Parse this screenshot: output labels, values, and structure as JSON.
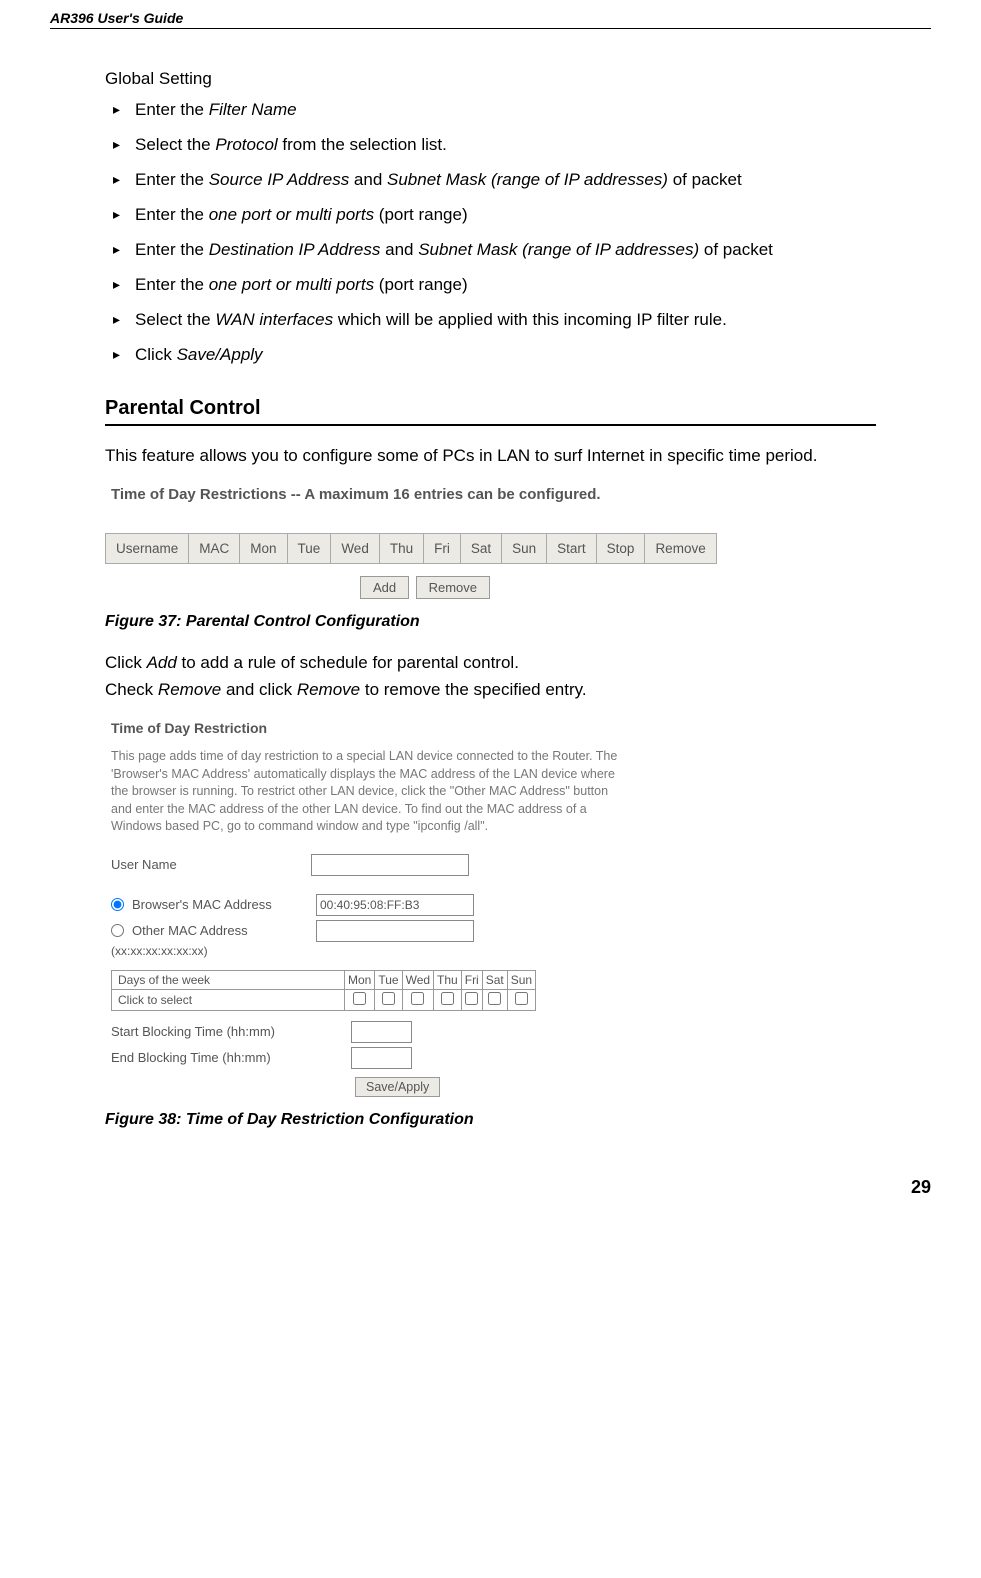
{
  "header": {
    "model": "AR396",
    "suffix": " User's Guide"
  },
  "global_setting": {
    "title": "Global Setting",
    "items": [
      {
        "pre": "Enter the ",
        "em": "Filter Name",
        "post": ""
      },
      {
        "pre": "Select the ",
        "em": "Protocol",
        "post": " from the selection list."
      },
      {
        "pre": "Enter the ",
        "em": "Source IP Address",
        "mid": " and ",
        "em2": "Subnet Mask (range of IP addresses)",
        "post": " of packet"
      },
      {
        "pre": "Enter the ",
        "em": "one port or multi ports",
        "post": " (port range)"
      },
      {
        "pre": "Enter the ",
        "em": "Destination IP Address",
        "mid": " and ",
        "em2": "Subnet Mask (range of IP addresses)",
        "post": " of packet"
      },
      {
        "pre": "Enter the ",
        "em": "one port or multi ports",
        "post": " (port range)"
      },
      {
        "pre": "Select the ",
        "em": "WAN interfaces",
        "post": " which will be applied with this incoming IP filter rule."
      },
      {
        "pre": "Click ",
        "em": "Save/Apply",
        "post": ""
      }
    ]
  },
  "parental": {
    "heading": "Parental Control",
    "para": "This feature allows you to configure some of PCs in LAN to surf Internet in specific time period.",
    "fig37": {
      "title": "Time of Day Restrictions -- A maximum 16 entries can be configured.",
      "cols": [
        "Username",
        "MAC",
        "Mon",
        "Tue",
        "Wed",
        "Thu",
        "Fri",
        "Sat",
        "Sun",
        "Start",
        "Stop",
        "Remove"
      ],
      "buttons": {
        "add": "Add",
        "remove": "Remove"
      },
      "caption": "Figure 37: Parental Control Configuration"
    },
    "instr": {
      "line1_pre": "Click ",
      "line1_em": "Add",
      "line1_post": " to add a rule of schedule for parental control.",
      "line2_pre": "Check ",
      "line2_em": "Remove",
      "line2_mid": " and click ",
      "line2_em2": "Remove",
      "line2_post": " to remove the specified entry."
    },
    "fig38": {
      "title": "Time of Day Restriction",
      "desc": "This page adds time of day restriction to a special LAN device connected to the Router. The 'Browser's MAC Address' automatically displays the MAC address of the LAN device where the browser is running. To restrict other LAN device, click the \"Other MAC Address\" button and enter the MAC address of the other LAN device. To find out the MAC address of a Windows based PC, go to command window and type \"ipconfig /all\".",
      "user_name_label": "User Name",
      "browsers_mac_label": "Browser's MAC Address",
      "browsers_mac_value": "00:40:95:08:FF:B3",
      "other_mac_label": "Other MAC Address",
      "other_mac_hint": "(xx:xx:xx:xx:xx:xx)",
      "dow_row1": "Days of the week",
      "dow_row2": "Click to select",
      "days": [
        "Mon",
        "Tue",
        "Wed",
        "Thu",
        "Fri",
        "Sat",
        "Sun"
      ],
      "start_label": "Start Blocking Time (hh:mm)",
      "end_label": "End Blocking Time (hh:mm)",
      "save_label": "Save/Apply",
      "caption": "Figure 38: Time of Day Restriction Configuration"
    }
  },
  "page_number": "29"
}
